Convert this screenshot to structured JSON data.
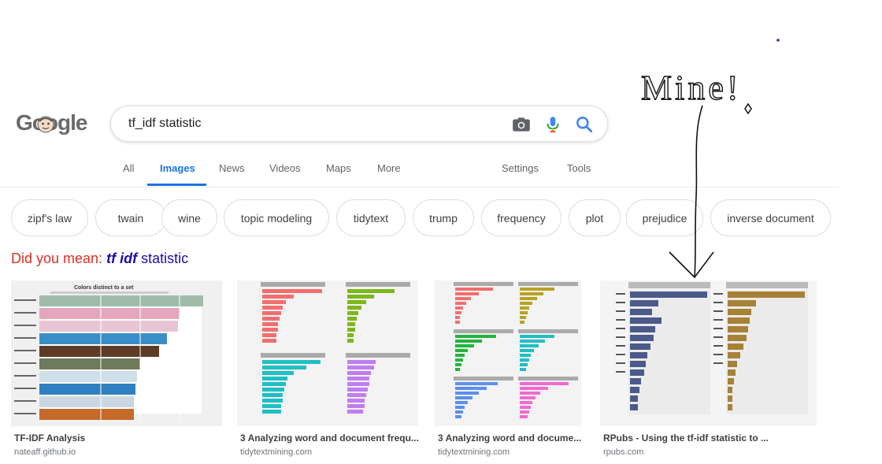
{
  "logo": {
    "text": "Google"
  },
  "search": {
    "query": "tf_idf statistic"
  },
  "tabs": [
    {
      "label": "All"
    },
    {
      "label": "Images"
    },
    {
      "label": "News"
    },
    {
      "label": "Videos"
    },
    {
      "label": "Maps"
    },
    {
      "label": "More"
    },
    {
      "label": "Settings"
    },
    {
      "label": "Tools"
    }
  ],
  "chips": [
    {
      "label": "zipf's law"
    },
    {
      "label": "twain"
    },
    {
      "label": "wine"
    },
    {
      "label": "topic modeling"
    },
    {
      "label": "tidytext"
    },
    {
      "label": "trump"
    },
    {
      "label": "frequency"
    },
    {
      "label": "plot"
    },
    {
      "label": "prejudice"
    },
    {
      "label": "inverse document"
    }
  ],
  "did_you_mean": {
    "label": "Did you mean:",
    "suggestion_bold_italic": "tf idf",
    "suggestion_rest": " statistic"
  },
  "results": [
    {
      "title": "TF-IDF Analysis",
      "source": "nateaff.github.io",
      "thumb_title": "Colors distinct to a set"
    },
    {
      "title": "3 Analyzing word and document frequ...",
      "source": "tidytextmining.com"
    },
    {
      "title": "3 Analyzing word and docume...",
      "source": "tidytextmining.com"
    },
    {
      "title": "RPubs - Using the tf-idf statistic to ...",
      "source": "rpubs.com"
    }
  ],
  "annotation": {
    "text": "Mine!"
  },
  "colors": {
    "accent_blue": "#1a73e8",
    "did_you_mean_red": "#d93025",
    "link_blue": "#1a0dab",
    "tab_grey": "#5f6368"
  }
}
